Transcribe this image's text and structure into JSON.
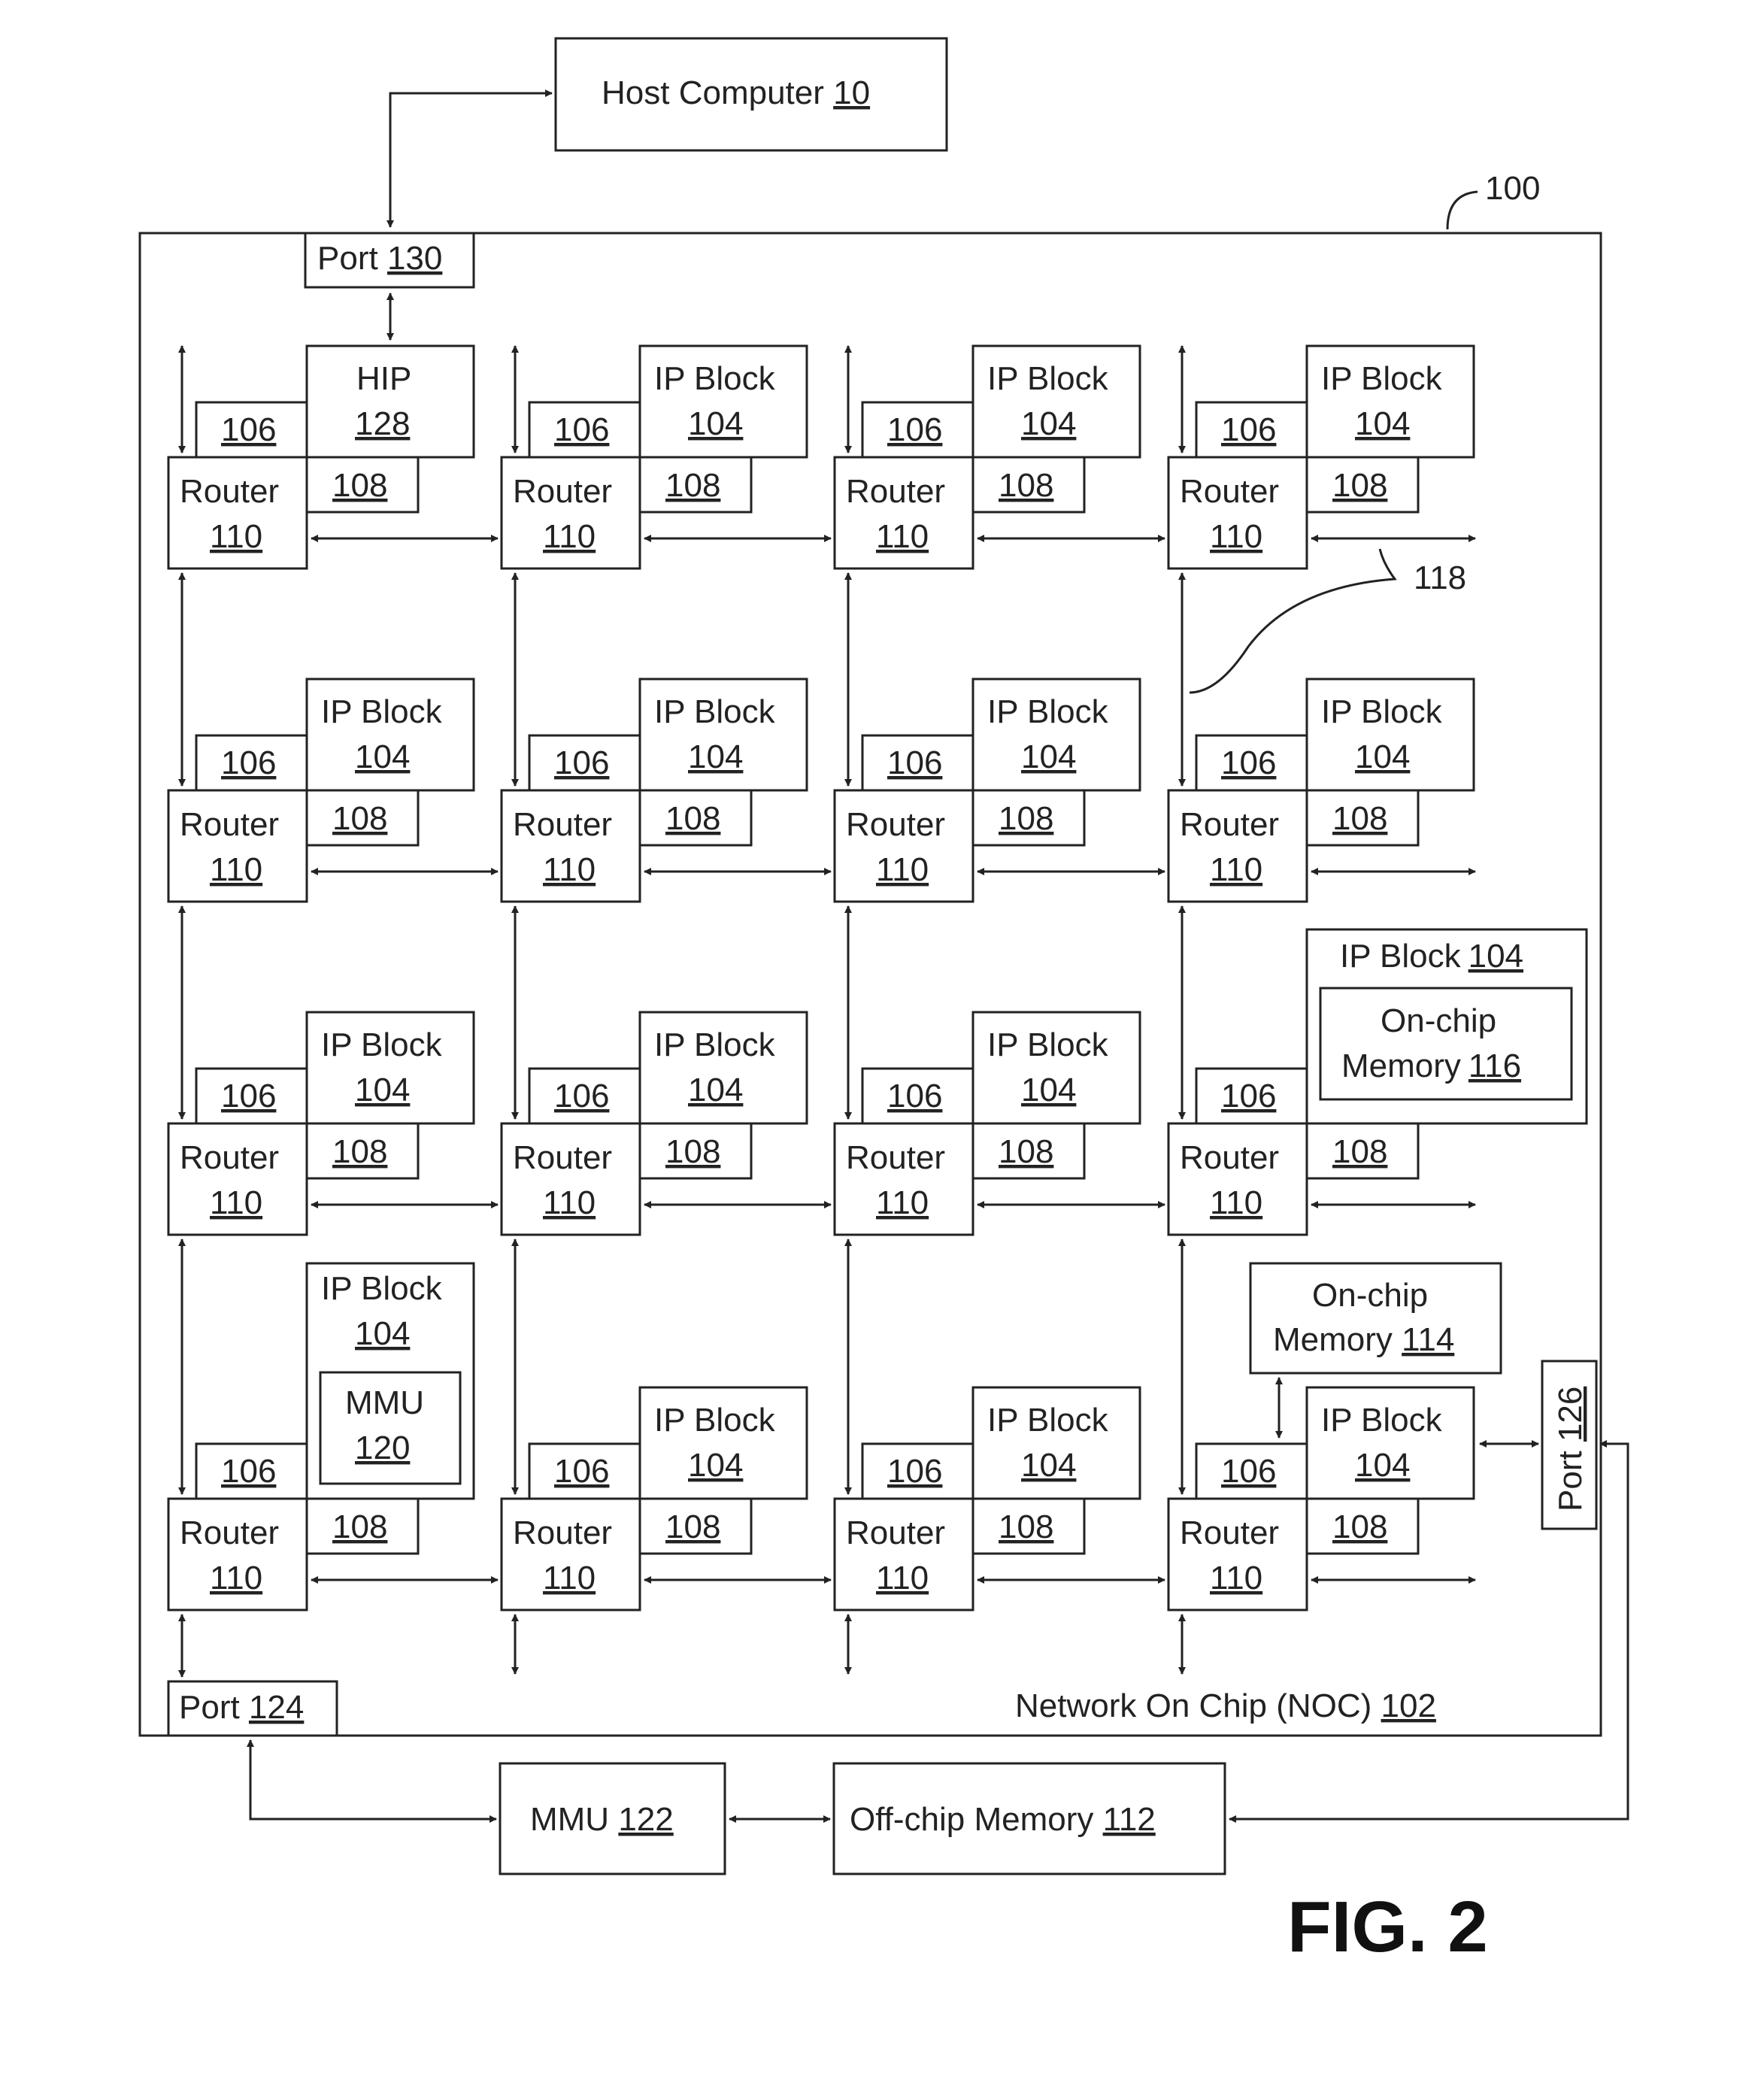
{
  "figure_label": "FIG. 2",
  "host": {
    "label": "Host Computer",
    "ref": "10"
  },
  "system_ref": "100",
  "noc": {
    "label": "Network On Chip (NOC)",
    "ref": "102"
  },
  "port130": {
    "label": "Port",
    "ref": "130"
  },
  "port124": {
    "label": "Port",
    "ref": "124"
  },
  "port126": {
    "label": "Port",
    "ref": "126"
  },
  "link_ref": "118",
  "hip": {
    "label": "HIP",
    "ref": "128"
  },
  "router": {
    "label": "Router",
    "ref": "110"
  },
  "ip_block": {
    "label": "IP Block",
    "ref": "104"
  },
  "ref106": "106",
  "ref108": "108",
  "mmu120": {
    "label": "MMU",
    "ref": "120"
  },
  "onchip116": {
    "line1": "On-chip",
    "line2": "Memory",
    "ref": "116"
  },
  "onchip114": {
    "line1": "On-chip",
    "line2": "Memory",
    "ref": "114"
  },
  "mmu122": {
    "label": "MMU",
    "ref": "122"
  },
  "offchip112": {
    "label": "Off-chip  Memory",
    "ref": "112"
  }
}
